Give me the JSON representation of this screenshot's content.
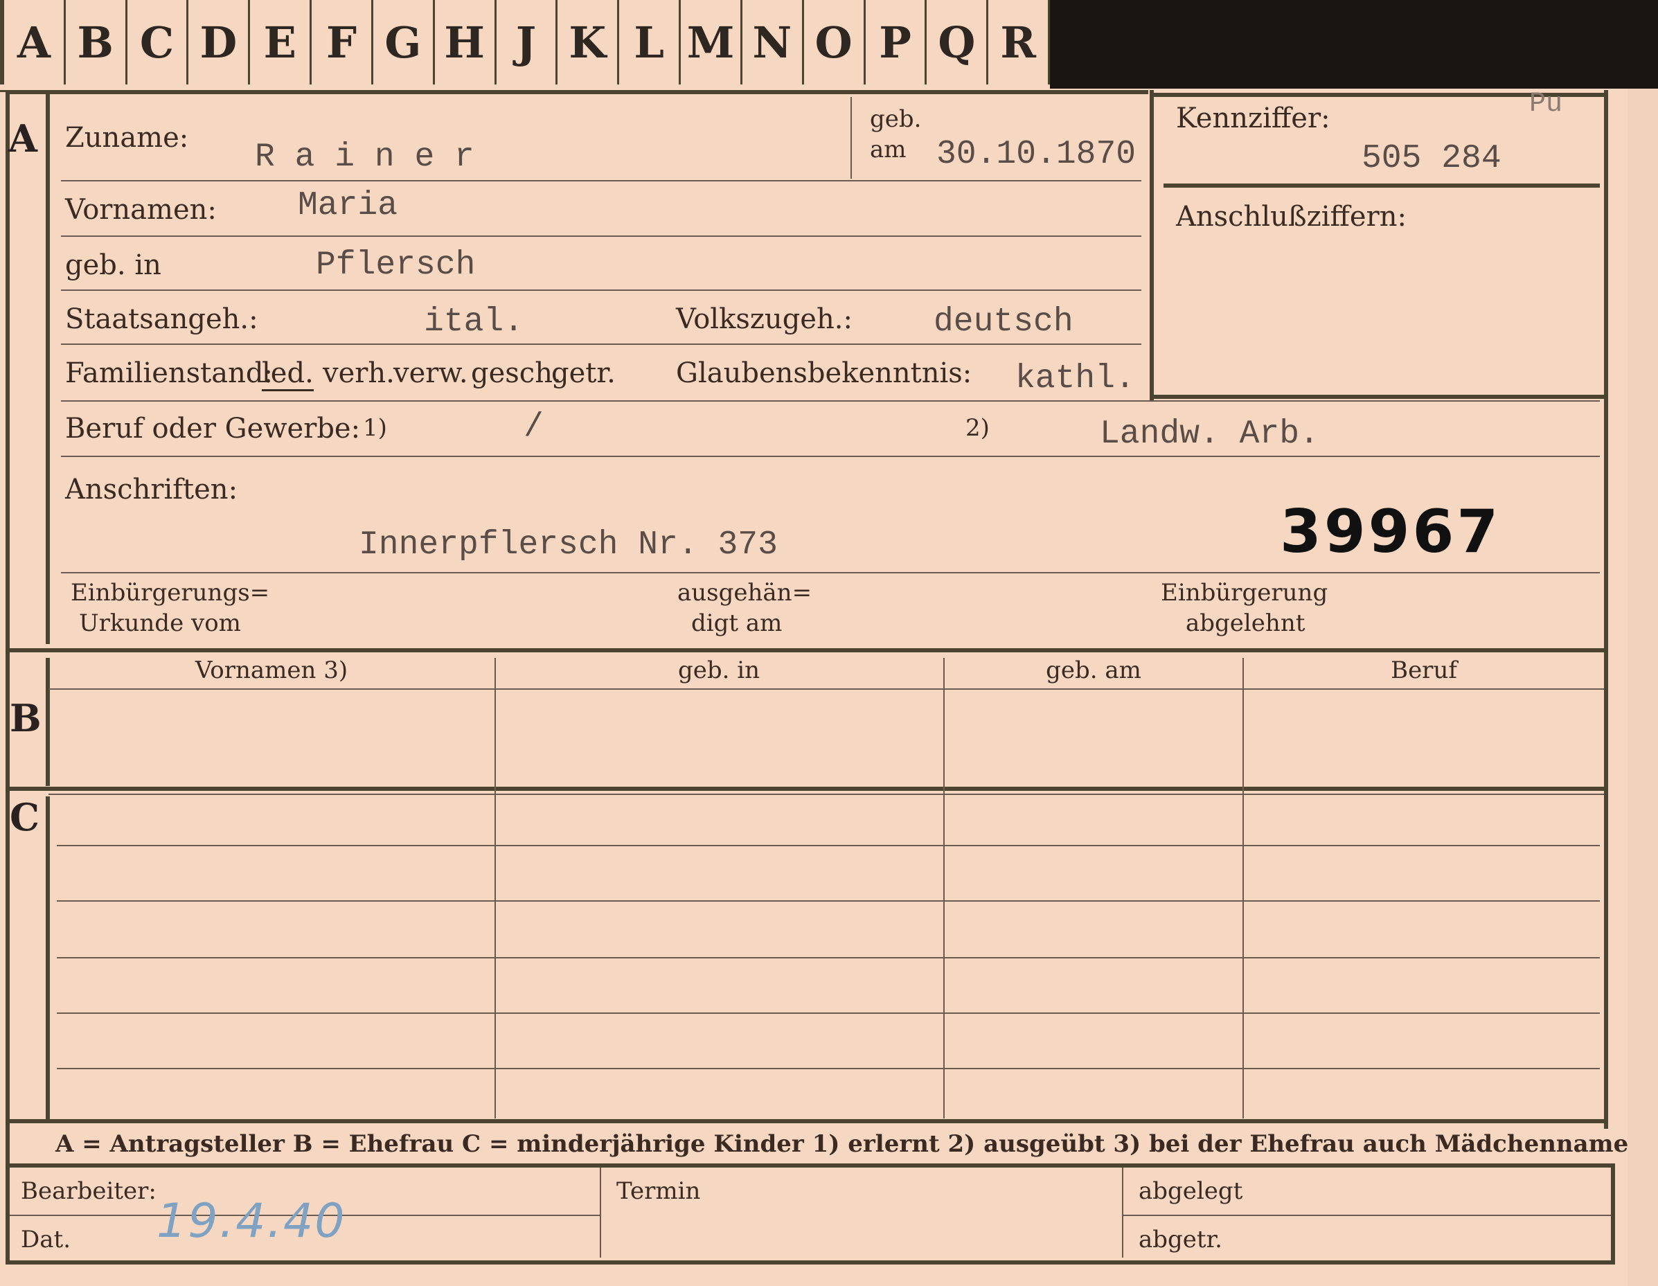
{
  "tabs": [
    "A",
    "B",
    "C",
    "D",
    "E",
    "F",
    "G",
    "H",
    "J",
    "K",
    "L",
    "M",
    "N",
    "O",
    "P",
    "Q",
    "R"
  ],
  "sections": {
    "a": "A",
    "b": "B",
    "c": "C"
  },
  "corner_mark": "Pu",
  "fields": {
    "zuname": {
      "label": "Zuname:",
      "value": "R a i n e r"
    },
    "geb_am": {
      "label_top": "geb.",
      "label_bottom": "am",
      "value": "30.10.1870"
    },
    "kennziffer": {
      "label": "Kennziffer:",
      "value": "505 284"
    },
    "anschlussziffern": {
      "label": "Anschlußziffern:"
    },
    "vornamen": {
      "label": "Vornamen:",
      "value": "Maria"
    },
    "geb_in": {
      "label": "geb. in",
      "value": "Pflersch"
    },
    "staatsangeh": {
      "label": "Staatsangeh.:",
      "value": "ital."
    },
    "volkszugeh": {
      "label": "Volkszugeh.:",
      "value": "deutsch"
    },
    "familienstand": {
      "label": "Familienstand:",
      "options": [
        "led.",
        "verh.",
        "verw.",
        "gesch.",
        "getr."
      ],
      "selected": "led."
    },
    "glaubensbekenntnis": {
      "label": "Glaubensbekenntnis:",
      "value": "kathl."
    },
    "beruf": {
      "label": "Beruf oder Gewerbe:",
      "mark1": "1)",
      "value1": "/",
      "mark2": "2)",
      "value2": "Landw. Arb."
    },
    "anschriften": {
      "label": "Anschriften:",
      "value": "Innerpflersch Nr. 373"
    },
    "stamp_number": "39967",
    "einbuergerung_urkunde": {
      "line1": "Einbürgerungs=",
      "line2": "Urkunde vom"
    },
    "ausgehaendigt": {
      "line1": "ausgehän=",
      "line2": "digt am"
    },
    "einbuergerung_abgelehnt": {
      "line1": "Einbürgerung",
      "line2": "abgelehnt"
    }
  },
  "table_columns": [
    "Vornamen 3)",
    "geb. in",
    "geb. am",
    "Beruf"
  ],
  "legend": "A = Antragsteller   B = Ehefrau   C = minderjährige Kinder   1) erlernt   2) ausgeübt   3) bei der Ehefrau auch Mädchenname",
  "footer": {
    "bearbeiter": "Bearbeiter:",
    "termin": "Termin",
    "abgelegt": "abgelegt",
    "dat": "Dat.",
    "dat_value": "19.4.40",
    "abgetr": "abgetr."
  }
}
